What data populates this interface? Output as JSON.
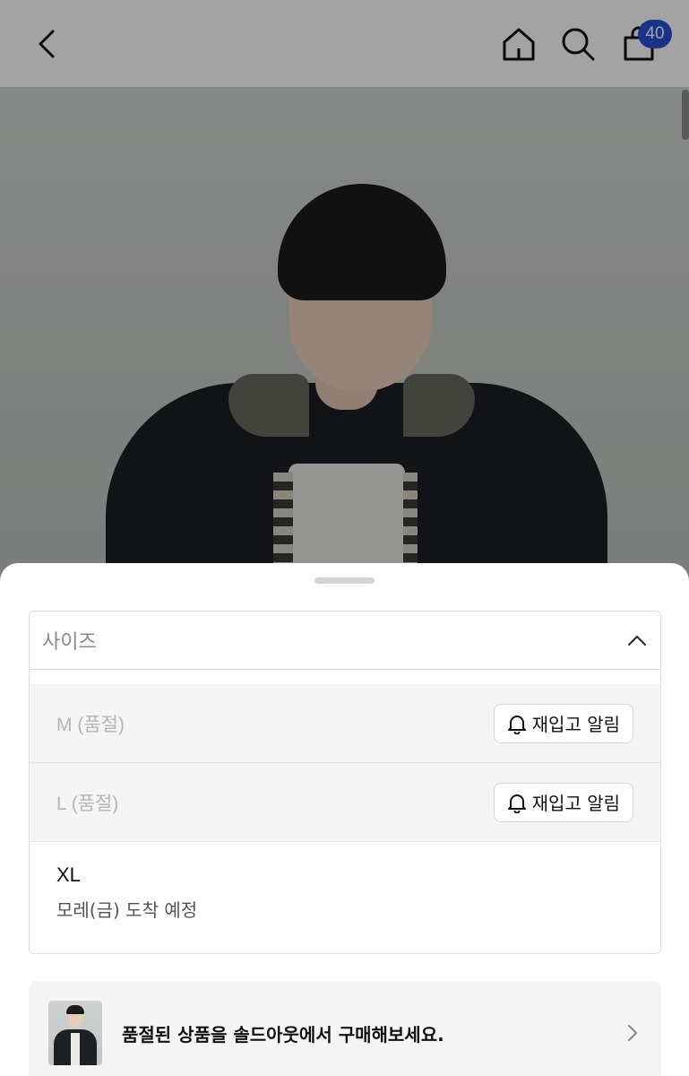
{
  "header": {
    "back_icon": "chevron-left-icon",
    "home_icon": "home-icon",
    "search_icon": "search-icon",
    "bag_icon": "shopping-bag-icon",
    "cart_count": "40",
    "badge_color": "#2b4fd6"
  },
  "size_selector": {
    "placeholder": "사이즈",
    "toggle_icon": "chevron-up-icon",
    "options": [
      {
        "label": "M (품절)",
        "status": "soldout",
        "button_label": "재입고 알림",
        "button_icon": "bell-icon"
      },
      {
        "label": "L (품절)",
        "status": "soldout",
        "button_label": "재입고 알림",
        "button_icon": "bell-icon"
      },
      {
        "label": "XL",
        "status": "available",
        "note": "모레(금) 도착 예정"
      }
    ]
  },
  "soldout_banner": {
    "text": "품절된 상품을 솔드아웃에서 구매해보세요.",
    "arrow_icon": "chevron-right-icon"
  }
}
